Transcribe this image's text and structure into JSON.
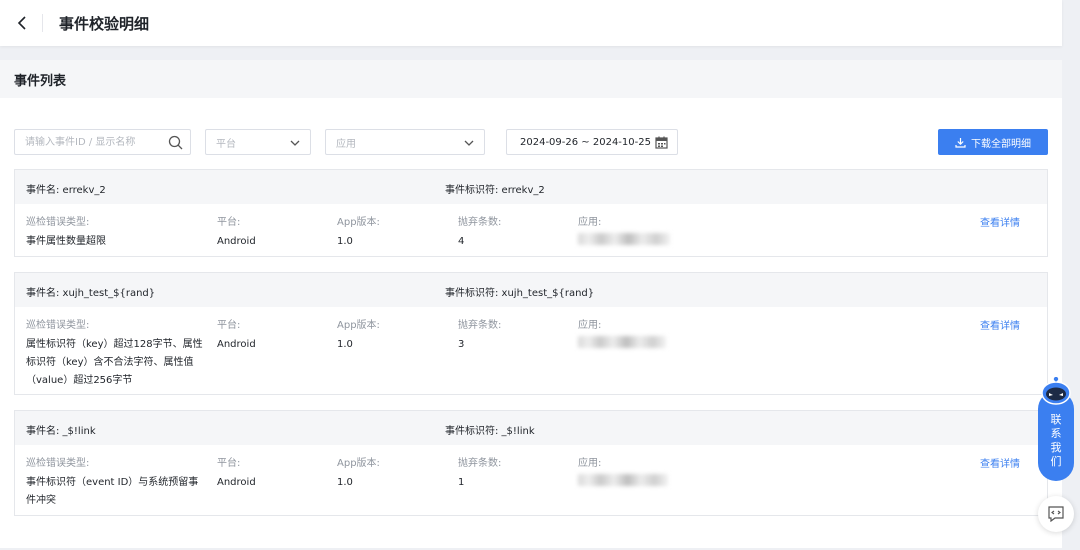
{
  "header": {
    "title": "事件校验明细"
  },
  "section": {
    "title": "事件列表"
  },
  "filters": {
    "search_placeholder": "请输入事件ID / 显示名称",
    "platform_placeholder": "平台",
    "app_placeholder": "应用",
    "date_range": "2024-09-26 ~ 2024-10-25",
    "download_label": "下载全部明细"
  },
  "labels": {
    "error_type": "巡检错误类型:",
    "platform": "平台:",
    "app_version": "App版本:",
    "discard_count": "抛弃条数:",
    "app": "应用:",
    "view_detail": "查看详情"
  },
  "events": [
    {
      "name": "事件名: errekv_2",
      "identifier": "事件标识符: errekv_2",
      "error_type": "事件属性数量超限",
      "platform": "Android",
      "app_version": "1.0",
      "discard_count": "4"
    },
    {
      "name": "事件名: xujh_test_${rand}",
      "identifier": "事件标识符: xujh_test_${rand}",
      "error_type": "属性标识符（key）超过128字节、属性标识符（key）含不合法字符、属性值（value）超过256字节",
      "platform": "Android",
      "app_version": "1.0",
      "discard_count": "3"
    },
    {
      "name": "事件名: _$!link",
      "identifier": "事件标识符: _$!link",
      "error_type": "事件标识符（event ID）与系统预留事件冲突",
      "platform": "Android",
      "app_version": "1.0",
      "discard_count": "1"
    }
  ],
  "assistant": {
    "label": "联系我们"
  },
  "colors": {
    "primary": "#3b7ff0",
    "muted": "#8f959e"
  }
}
